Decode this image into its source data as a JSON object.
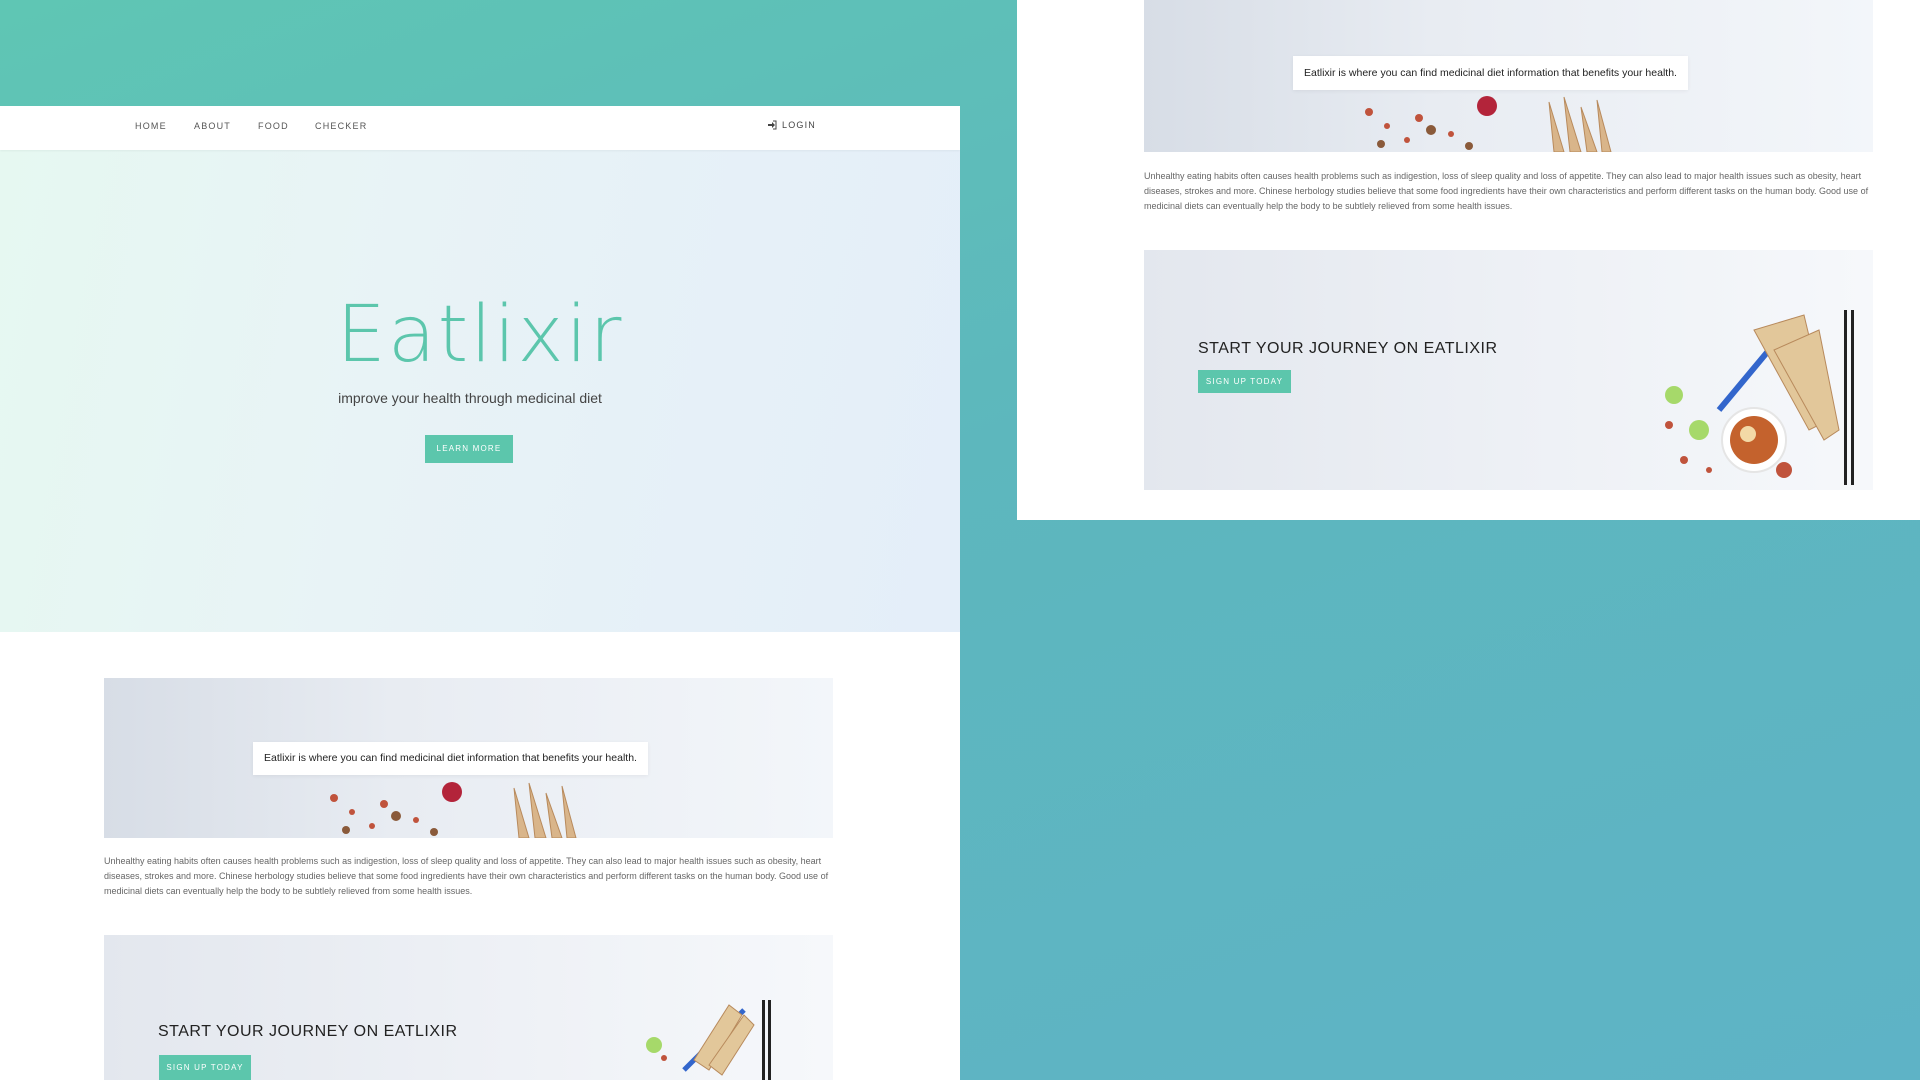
{
  "site": {
    "nav": {
      "items": [
        "HOME",
        "ABOUT",
        "FOOD",
        "CHECKER"
      ],
      "login": "LOGIN"
    },
    "hero": {
      "title": "Eatlixir",
      "subtitle": "improve your health through medicinal diet",
      "button": "LEARN MORE"
    },
    "intro_banner": {
      "text": "Eatlixir is where you can find medicinal diet information that benefits your health."
    },
    "description": "Unhealthy eating habits often causes health problems such as indigestion, loss of sleep quality and loss of appetite. They can also lead to major health issues such as obesity, heart diseases, strokes and more. Chinese herbology studies believe that some food ingredients have their own characteristics and perform different tasks on the human body. Good use of medicinal diets can eventually help the body to be subtlely relieved from some health issues.",
    "cta": {
      "title": "START YOUR JOURNEY ON EATLIXIR",
      "button": "SIGN UP TODAY"
    }
  },
  "icons": {
    "login": "sign-in-icon"
  },
  "colors": {
    "accent": "#5cc6ac",
    "background": "#5fbcc0"
  }
}
